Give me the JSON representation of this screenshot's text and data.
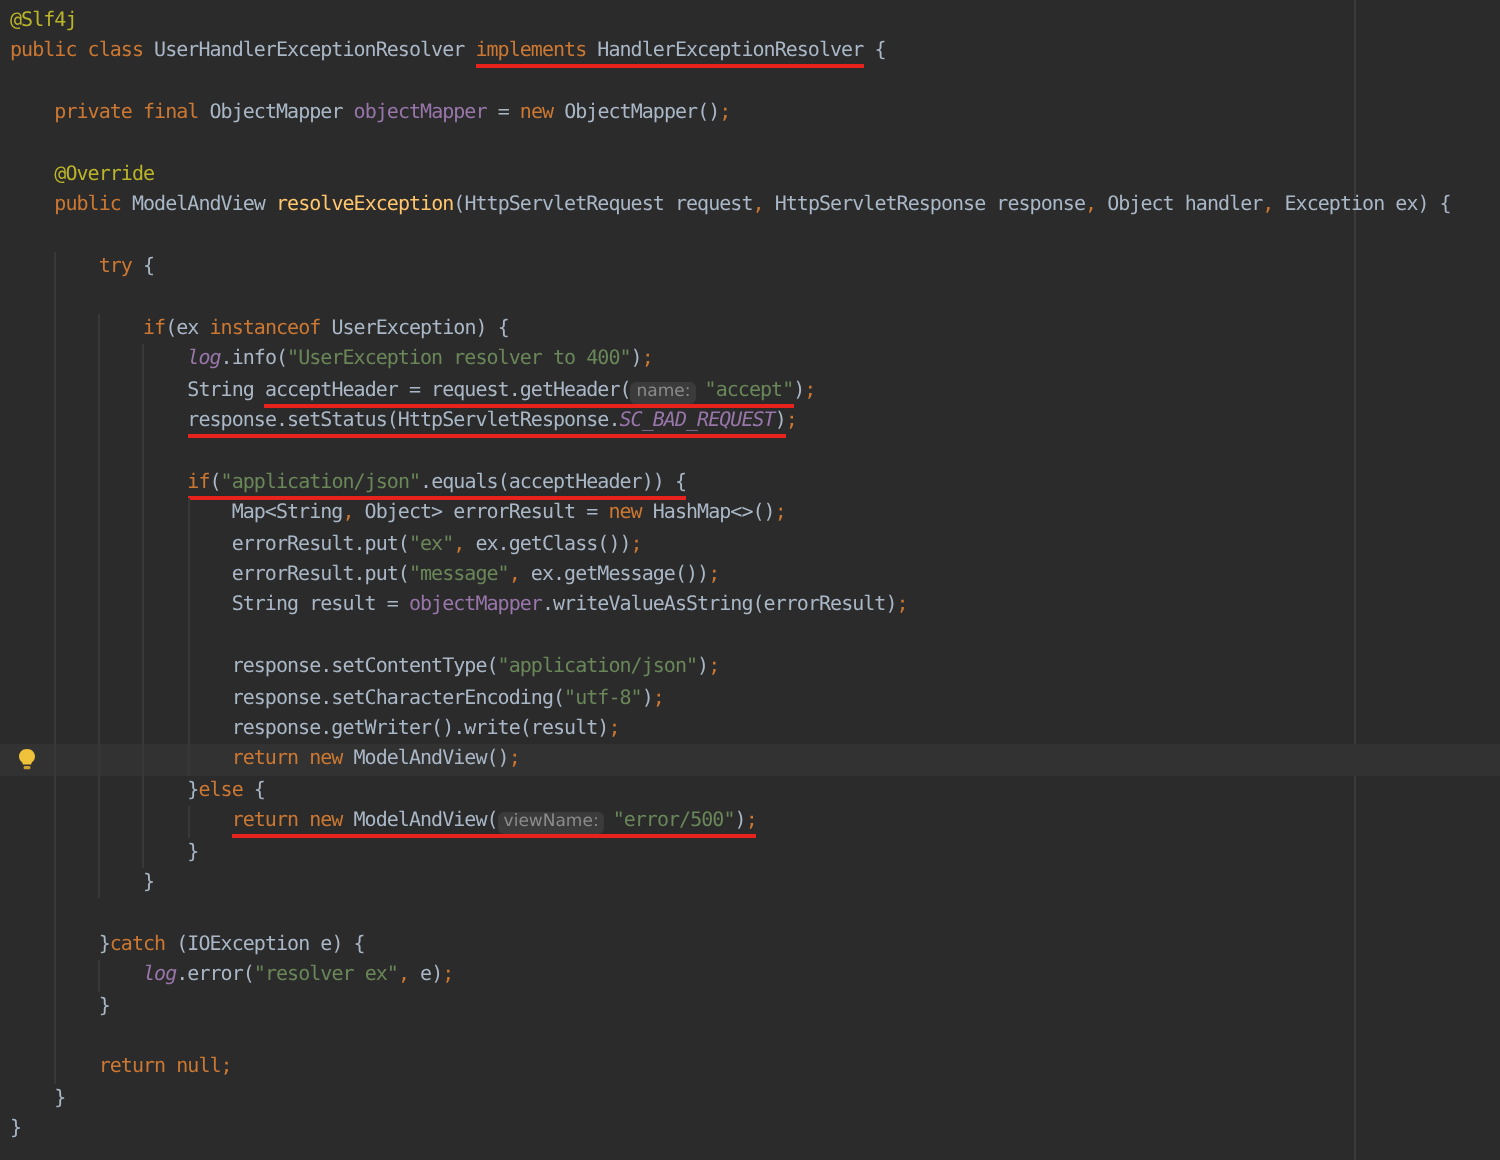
{
  "editor": {
    "lines": [
      {
        "current": false,
        "segments": [
          {
            "underlined": false,
            "tokens": [
              {
                "text": "@Slf4j",
                "kind": "annotation"
              }
            ]
          }
        ]
      },
      {
        "current": false,
        "segments": [
          {
            "underlined": false,
            "tokens": [
              {
                "text": "public class ",
                "kind": "keyword"
              },
              {
                "text": "UserHandlerExceptionResolver ",
                "kind": "plain"
              }
            ]
          },
          {
            "underlined": true,
            "tokens": [
              {
                "text": "implements",
                "kind": "keyword"
              },
              {
                "text": " HandlerExceptionResolver",
                "kind": "plain"
              }
            ]
          },
          {
            "underlined": false,
            "tokens": [
              {
                "text": " {",
                "kind": "plain"
              }
            ]
          }
        ]
      },
      {
        "current": false
      },
      {
        "current": false,
        "segments": [
          {
            "underlined": false,
            "tokens": [
              {
                "text": "    private final ",
                "kind": "keyword"
              },
              {
                "text": "ObjectMapper ",
                "kind": "plain"
              },
              {
                "text": "objectMapper",
                "kind": "field"
              },
              {
                "text": " = ",
                "kind": "plain"
              },
              {
                "text": "new ",
                "kind": "keyword"
              },
              {
                "text": "ObjectMapper()",
                "kind": "plain"
              },
              {
                "text": ";",
                "kind": "keyword"
              }
            ]
          }
        ]
      },
      {
        "current": false
      },
      {
        "current": false,
        "segments": [
          {
            "underlined": false,
            "tokens": [
              {
                "text": "    @Override",
                "kind": "annotation"
              }
            ]
          }
        ]
      },
      {
        "current": false,
        "segments": [
          {
            "underlined": false,
            "tokens": [
              {
                "text": "    public ",
                "kind": "keyword"
              },
              {
                "text": "ModelAndView ",
                "kind": "plain"
              },
              {
                "text": "resolveException",
                "kind": "method"
              },
              {
                "text": "(HttpServletRequest request",
                "kind": "plain"
              },
              {
                "text": ",",
                "kind": "keyword"
              },
              {
                "text": " HttpServletResponse response",
                "kind": "plain"
              },
              {
                "text": ",",
                "kind": "keyword"
              },
              {
                "text": " Object handler",
                "kind": "plain"
              },
              {
                "text": ",",
                "kind": "keyword"
              },
              {
                "text": " Exception ex) {",
                "kind": "plain"
              }
            ]
          }
        ]
      },
      {
        "current": false
      },
      {
        "current": false,
        "segments": [
          {
            "underlined": false,
            "tokens": [
              {
                "text": "        try ",
                "kind": "keyword"
              },
              {
                "text": "{",
                "kind": "plain"
              }
            ]
          }
        ]
      },
      {
        "current": false
      },
      {
        "current": false,
        "segments": [
          {
            "underlined": false,
            "tokens": [
              {
                "text": "            if",
                "kind": "keyword"
              },
              {
                "text": "(ex ",
                "kind": "plain"
              },
              {
                "text": "instanceof ",
                "kind": "keyword"
              },
              {
                "text": "UserException) {",
                "kind": "plain"
              }
            ]
          }
        ]
      },
      {
        "current": false,
        "segments": [
          {
            "underlined": false,
            "tokens": [
              {
                "text": "                log",
                "kind": "static"
              },
              {
                "text": ".info(",
                "kind": "plain"
              },
              {
                "text": "\"UserException resolver to 400\"",
                "kind": "string"
              },
              {
                "text": ")",
                "kind": "plain"
              },
              {
                "text": ";",
                "kind": "keyword"
              }
            ]
          }
        ]
      },
      {
        "current": false,
        "segments": [
          {
            "underlined": false,
            "tokens": [
              {
                "text": "                String ",
                "kind": "plain"
              }
            ]
          },
          {
            "underlined": true,
            "tokens": [
              {
                "text": "acceptHeader = request.getHeader(",
                "kind": "plain"
              },
              {
                "text": "name:",
                "kind": "hint"
              },
              {
                "text": "\"accept\"",
                "kind": "string"
              }
            ]
          },
          {
            "underlined": false,
            "tokens": [
              {
                "text": ")",
                "kind": "plain"
              },
              {
                "text": ";",
                "kind": "keyword"
              }
            ]
          }
        ]
      },
      {
        "current": false,
        "segments": [
          {
            "underlined": true,
            "tokens": [
              {
                "text": "                response.setStatus(HttpServletResponse.",
                "kind": "plain"
              },
              {
                "text": "SC_BAD_REQUEST",
                "kind": "static"
              },
              {
                "text": ")",
                "kind": "plain"
              }
            ]
          },
          {
            "underlined": false,
            "tokens": [
              {
                "text": ";",
                "kind": "keyword"
              }
            ]
          }
        ]
      },
      {
        "current": false
      },
      {
        "current": false,
        "segments": [
          {
            "underlined": true,
            "tokens": [
              {
                "text": "                if",
                "kind": "keyword"
              },
              {
                "text": "(",
                "kind": "plain"
              },
              {
                "text": "\"application/json\"",
                "kind": "string"
              },
              {
                "text": ".equals(acceptHeader)) {",
                "kind": "plain"
              }
            ]
          }
        ]
      },
      {
        "current": false,
        "segments": [
          {
            "underlined": false,
            "tokens": [
              {
                "text": "                    Map<String",
                "kind": "plain"
              },
              {
                "text": ",",
                "kind": "keyword"
              },
              {
                "text": " Object> errorResult = ",
                "kind": "plain"
              },
              {
                "text": "new ",
                "kind": "keyword"
              },
              {
                "text": "HashMap<>()",
                "kind": "plain"
              },
              {
                "text": ";",
                "kind": "keyword"
              }
            ]
          }
        ]
      },
      {
        "current": false,
        "segments": [
          {
            "underlined": false,
            "tokens": [
              {
                "text": "                    errorResult.put(",
                "kind": "plain"
              },
              {
                "text": "\"ex\"",
                "kind": "string"
              },
              {
                "text": ",",
                "kind": "keyword"
              },
              {
                "text": " ex.getClass())",
                "kind": "plain"
              },
              {
                "text": ";",
                "kind": "keyword"
              }
            ]
          }
        ]
      },
      {
        "current": false,
        "segments": [
          {
            "underlined": false,
            "tokens": [
              {
                "text": "                    errorResult.put(",
                "kind": "plain"
              },
              {
                "text": "\"message\"",
                "kind": "string"
              },
              {
                "text": ",",
                "kind": "keyword"
              },
              {
                "text": " ex.getMessage())",
                "kind": "plain"
              },
              {
                "text": ";",
                "kind": "keyword"
              }
            ]
          }
        ]
      },
      {
        "current": false,
        "segments": [
          {
            "underlined": false,
            "tokens": [
              {
                "text": "                    String result = ",
                "kind": "plain"
              },
              {
                "text": "objectMapper",
                "kind": "field"
              },
              {
                "text": ".writeValueAsString(errorResult)",
                "kind": "plain"
              },
              {
                "text": ";",
                "kind": "keyword"
              }
            ]
          }
        ]
      },
      {
        "current": false
      },
      {
        "current": false,
        "segments": [
          {
            "underlined": false,
            "tokens": [
              {
                "text": "                    response.setContentType(",
                "kind": "plain"
              },
              {
                "text": "\"application/json\"",
                "kind": "string"
              },
              {
                "text": ")",
                "kind": "plain"
              },
              {
                "text": ";",
                "kind": "keyword"
              }
            ]
          }
        ]
      },
      {
        "current": false,
        "segments": [
          {
            "underlined": false,
            "tokens": [
              {
                "text": "                    response.setCharacterEncoding(",
                "kind": "plain"
              },
              {
                "text": "\"utf-8\"",
                "kind": "string"
              },
              {
                "text": ")",
                "kind": "plain"
              },
              {
                "text": ";",
                "kind": "keyword"
              }
            ]
          }
        ]
      },
      {
        "current": false,
        "segments": [
          {
            "underlined": false,
            "tokens": [
              {
                "text": "                    response.getWriter().write(result)",
                "kind": "plain"
              },
              {
                "text": ";",
                "kind": "keyword"
              }
            ]
          }
        ]
      },
      {
        "current": true,
        "segments": [
          {
            "underlined": false,
            "tokens": [
              {
                "text": "                    return new ",
                "kind": "keyword"
              },
              {
                "text": "ModelAndView()",
                "kind": "plain"
              },
              {
                "text": ";",
                "kind": "keyword"
              }
            ]
          }
        ]
      },
      {
        "current": false,
        "segments": [
          {
            "underlined": false,
            "tokens": [
              {
                "text": "                }",
                "kind": "plain"
              },
              {
                "text": "else ",
                "kind": "keyword"
              },
              {
                "text": "{",
                "kind": "plain"
              }
            ]
          }
        ]
      },
      {
        "current": false,
        "segments": [
          {
            "underlined": true,
            "tokens": [
              {
                "text": "                    return new ",
                "kind": "keyword"
              },
              {
                "text": "ModelAndView(",
                "kind": "plain"
              },
              {
                "text": "viewName:",
                "kind": "hint"
              },
              {
                "text": "\"error/500\"",
                "kind": "string"
              },
              {
                "text": ")",
                "kind": "plain"
              },
              {
                "text": ";",
                "kind": "keyword"
              }
            ]
          }
        ]
      },
      {
        "current": false,
        "segments": [
          {
            "underlined": false,
            "tokens": [
              {
                "text": "                }",
                "kind": "plain"
              }
            ]
          }
        ]
      },
      {
        "current": false,
        "segments": [
          {
            "underlined": false,
            "tokens": [
              {
                "text": "            }",
                "kind": "plain"
              }
            ]
          }
        ]
      },
      {
        "current": false
      },
      {
        "current": false,
        "segments": [
          {
            "underlined": false,
            "tokens": [
              {
                "text": "        }",
                "kind": "plain"
              },
              {
                "text": "catch ",
                "kind": "keyword"
              },
              {
                "text": "(IOException e) {",
                "kind": "plain"
              }
            ]
          }
        ]
      },
      {
        "current": false,
        "segments": [
          {
            "underlined": false,
            "tokens": [
              {
                "text": "            log",
                "kind": "static"
              },
              {
                "text": ".error(",
                "kind": "plain"
              },
              {
                "text": "\"resolver ex\"",
                "kind": "string"
              },
              {
                "text": ",",
                "kind": "keyword"
              },
              {
                "text": " e)",
                "kind": "plain"
              },
              {
                "text": ";",
                "kind": "keyword"
              }
            ]
          }
        ]
      },
      {
        "current": false,
        "segments": [
          {
            "underlined": false,
            "tokens": [
              {
                "text": "        }",
                "kind": "plain"
              }
            ]
          }
        ]
      },
      {
        "current": false
      },
      {
        "current": false,
        "segments": [
          {
            "underlined": false,
            "tokens": [
              {
                "text": "        return null;",
                "kind": "keyword"
              }
            ]
          }
        ]
      },
      {
        "current": false,
        "segments": [
          {
            "underlined": false,
            "tokens": [
              {
                "text": "    }",
                "kind": "plain"
              }
            ]
          }
        ]
      },
      {
        "current": false,
        "segments": [
          {
            "underlined": false,
            "tokens": [
              {
                "text": "}",
                "kind": "plain"
              }
            ]
          }
        ]
      }
    ]
  }
}
